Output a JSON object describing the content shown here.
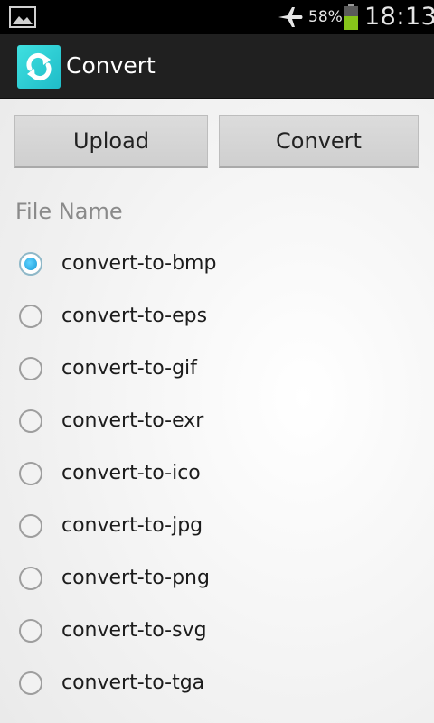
{
  "status_bar": {
    "battery_percent": "58%",
    "time": "18:13",
    "icons": [
      "picture-icon",
      "airplane-mode-icon",
      "battery-icon"
    ]
  },
  "action_bar": {
    "title": "Convert",
    "icon": "refresh-icon",
    "icon_color": "#2cc9d2"
  },
  "buttons": {
    "upload": "Upload",
    "convert": "Convert"
  },
  "file_section": {
    "title": "File Name",
    "selected_index": 0,
    "options": [
      "convert-to-bmp",
      "convert-to-eps",
      "convert-to-gif",
      "convert-to-exr",
      "convert-to-ico",
      "convert-to-jpg",
      "convert-to-png",
      "convert-to-svg",
      "convert-to-tga"
    ]
  }
}
